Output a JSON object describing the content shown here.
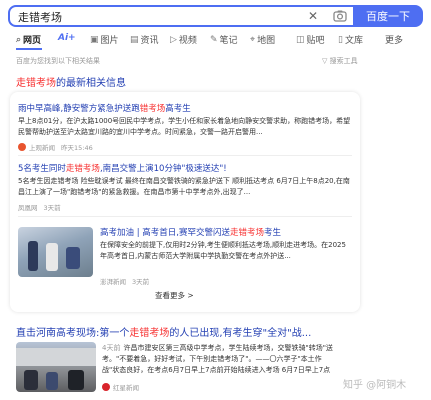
{
  "search": {
    "query": "走错考场",
    "button_label": "百度一下"
  },
  "tabs": [
    {
      "label": "网页",
      "icon": "search-icon"
    },
    {
      "label": "Ai+",
      "icon": ""
    },
    {
      "label": "图片",
      "icon": "image-icon"
    },
    {
      "label": "资讯",
      "icon": "news-icon"
    },
    {
      "label": "视频",
      "icon": "video-icon"
    },
    {
      "label": "笔记",
      "icon": "note-icon"
    },
    {
      "label": "地图",
      "icon": "map-icon"
    },
    {
      "label": "贴吧",
      "icon": "tieba-icon"
    },
    {
      "label": "文库",
      "icon": "doc-icon"
    },
    {
      "label": "更多",
      "icon": ""
    }
  ],
  "hint": "百度为您找到以下相关结果",
  "tools_label": "搜索工具",
  "latest": {
    "keyword": "走错考场",
    "suffix": "的最新相关信息"
  },
  "news": [
    {
      "title_pre": "雨中早高峰,静安警方紧急护送跑",
      "title_key": "错考场",
      "title_post": "高考生",
      "text": "早上8点01分，在沪太路1000号回民中学考点，学生小任和家长着急地向静安交警求助，称跑错考场，希望民警帮助护送至沪太路宜川路的宜川中学考点。时间紧急，交警一路开启警用...",
      "source": "上观新闻",
      "time": "昨天15:46",
      "source_color": "#e8542e"
    },
    {
      "title_pre": "5名考生同时",
      "title_key": "走错考场",
      "title_post": ",南昌交警上演10分钟\"极速送达\"!",
      "text": "5名考生因走错考场 险些耽误考试 最终在南昌交警铁骑的紧急护送下 顺利抵达考点 6月7日上午8点20,在南昌江上演了一场\"跑错考场\"的紧急救援。在南昌市第十中学考点外,出现了...",
      "source": "凤凰网",
      "time": "3天前",
      "source_color": "#d8242b"
    },
    {
      "title_pre": "高考加油 | 高考首日,赛罕交警闪送",
      "title_key": "走错考场",
      "title_post": "考生",
      "text": "在保障安全的前提下,仅用时2分钟,考生便顺利抵达考场,顺利走进考场。在2025年高考首日,内蒙古师范大学附属中学执勤交警在考点外护送...",
      "source": "澎湃新闻",
      "time": "3天前",
      "source_color": "#3a78c9"
    }
  ],
  "more_label": "查看更多 >",
  "result2": {
    "title_pre": "直击河南高考现场:第一个",
    "title_key": "走错考场",
    "title_post": "的人已出现,有考生穿\"全对\"战...",
    "text_date": "4天前",
    "text": "许昌市建安区第三高级中学考点，学生陆续考场，交警铁骑\"转场\"送考。\"不要着急，好好考试，下午别走错考场了\"。——〇六学子\"本土作战\"状态良好，在考点6月7日早上7点前开始陆续进入考场 6月7日早上7点看，在学校大门...",
    "source": "红星新闻",
    "source_color": "#d8242b"
  },
  "watermark": "知乎 @阿铜木"
}
